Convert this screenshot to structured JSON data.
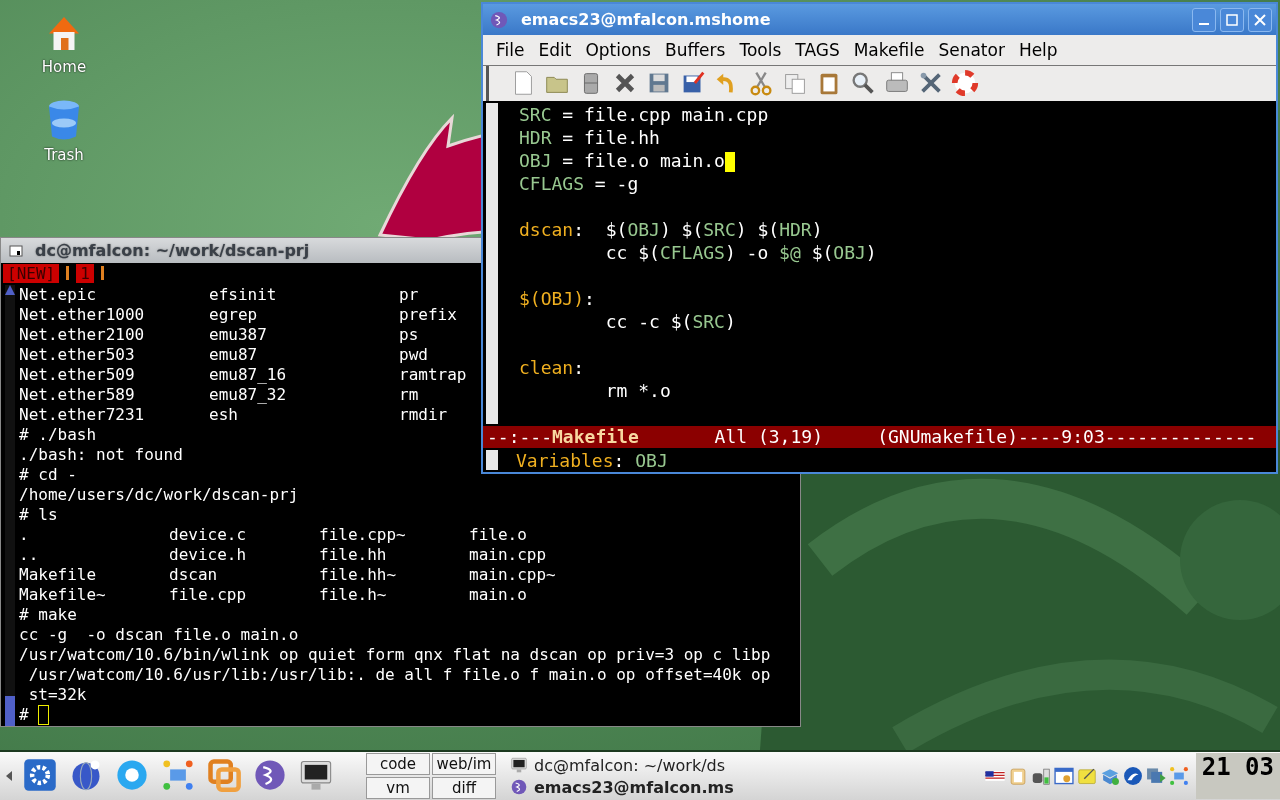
{
  "desktop": {
    "icons": [
      {
        "label": "Home",
        "kind": "home"
      },
      {
        "label": "Trash",
        "kind": "trash"
      }
    ]
  },
  "terminal": {
    "title": "dc@mfalcon: ~/work/dscan-prj",
    "tabs": [
      "[NEW]",
      "1"
    ],
    "lines": [
      {
        "kind": "wide",
        "cells": [
          "Net.epic",
          "efsinit",
          "pr"
        ]
      },
      {
        "kind": "wide",
        "cells": [
          "Net.ether1000",
          "egrep",
          "prefix"
        ]
      },
      {
        "kind": "wide",
        "cells": [
          "Net.ether2100",
          "emu387",
          "ps"
        ]
      },
      {
        "kind": "wide",
        "cells": [
          "Net.ether503",
          "emu87",
          "pwd"
        ]
      },
      {
        "kind": "wide",
        "cells": [
          "Net.ether509",
          "emu87_16",
          "ramtrap"
        ]
      },
      {
        "kind": "wide",
        "cells": [
          "Net.ether589",
          "emu87_32",
          "rm"
        ]
      },
      {
        "kind": "wide",
        "cells": [
          "Net.ether7231",
          "esh",
          "rmdir"
        ]
      },
      {
        "kind": "text",
        "text": "# ./bash"
      },
      {
        "kind": "text",
        "text": "./bash: not found"
      },
      {
        "kind": "text",
        "text": "# cd -"
      },
      {
        "kind": "text",
        "text": "/home/users/dc/work/dscan-prj"
      },
      {
        "kind": "text",
        "text": "# ls"
      },
      {
        "kind": "narrow",
        "cells": [
          ".",
          "device.c",
          "file.cpp~",
          "file.o"
        ]
      },
      {
        "kind": "narrow",
        "cells": [
          "..",
          "device.h",
          "file.hh",
          "main.cpp"
        ]
      },
      {
        "kind": "narrow",
        "cells": [
          "Makefile",
          "dscan",
          "file.hh~",
          "main.cpp~"
        ]
      },
      {
        "kind": "narrow",
        "cells": [
          "Makefile~",
          "file.cpp",
          "file.h~",
          "main.o"
        ]
      },
      {
        "kind": "text",
        "text": "# make"
      },
      {
        "kind": "text",
        "text": "cc -g  -o dscan file.o main.o"
      },
      {
        "kind": "text",
        "text": "/usr/watcom/10.6/bin/wlink op quiet form qnx flat na dscan op priv=3 op c libp"
      },
      {
        "kind": "text",
        "text": " /usr/watcom/10.6/usr/lib:/usr/lib:. de all f file.o f main.o op offset=40k op"
      },
      {
        "kind": "text",
        "text": " st=32k"
      },
      {
        "kind": "prompt",
        "text": "#"
      }
    ]
  },
  "emacs": {
    "title": "emacs23@mfalcon.mshome",
    "menu": [
      "File",
      "Edit",
      "Options",
      "Buffers",
      "Tools",
      "TAGS",
      "Makefile",
      "Senator",
      "Help"
    ],
    "lines": [
      {
        "kind": "code",
        "segments": [
          {
            "text": "SRC",
            "kind": "variable"
          },
          {
            "text": " = file.cpp main.cpp",
            "kind": "plain"
          }
        ],
        "cursor": false
      },
      {
        "kind": "code",
        "segments": [
          {
            "text": "HDR",
            "kind": "variable"
          },
          {
            "text": " = file.hh",
            "kind": "plain"
          }
        ],
        "cursor": false
      },
      {
        "kind": "code",
        "segments": [
          {
            "text": "OBJ",
            "kind": "variable"
          },
          {
            "text": " = file.o main.o",
            "kind": "plain"
          }
        ],
        "cursor": true
      },
      {
        "kind": "code",
        "segments": [
          {
            "text": "CFLAGS",
            "kind": "variable"
          },
          {
            "text": " = -g",
            "kind": "plain"
          }
        ],
        "cursor": false
      },
      {
        "kind": "blank"
      },
      {
        "kind": "code",
        "segments": [
          {
            "text": "dscan",
            "kind": "target"
          },
          {
            "text": ":  $(",
            "kind": "plain"
          },
          {
            "text": "OBJ",
            "kind": "variable"
          },
          {
            "text": ") $(",
            "kind": "plain"
          },
          {
            "text": "SRC",
            "kind": "variable"
          },
          {
            "text": ") $(",
            "kind": "plain"
          },
          {
            "text": "HDR",
            "kind": "variable"
          },
          {
            "text": ")",
            "kind": "plain"
          }
        ],
        "cursor": false
      },
      {
        "kind": "code",
        "segments": [
          {
            "text": "        cc $(",
            "kind": "plain"
          },
          {
            "text": "CFLAGS",
            "kind": "variable"
          },
          {
            "text": ") -o ",
            "kind": "plain"
          },
          {
            "text": "$@",
            "kind": "variable"
          },
          {
            "text": " $(",
            "kind": "plain"
          },
          {
            "text": "OBJ",
            "kind": "variable"
          },
          {
            "text": ")",
            "kind": "plain"
          }
        ],
        "cursor": false
      },
      {
        "kind": "blank"
      },
      {
        "kind": "code",
        "segments": [
          {
            "text": "$(OBJ)",
            "kind": "target"
          },
          {
            "text": ":",
            "kind": "plain"
          }
        ],
        "cursor": false
      },
      {
        "kind": "code",
        "segments": [
          {
            "text": "        cc -c $(",
            "kind": "plain"
          },
          {
            "text": "SRC",
            "kind": "variable"
          },
          {
            "text": ")",
            "kind": "plain"
          }
        ],
        "cursor": false
      },
      {
        "kind": "blank"
      },
      {
        "kind": "code",
        "segments": [
          {
            "text": "clean",
            "kind": "target"
          },
          {
            "text": ":",
            "kind": "plain"
          }
        ],
        "cursor": false
      },
      {
        "kind": "code",
        "segments": [
          {
            "text": "        rm *.o",
            "kind": "plain"
          }
        ],
        "cursor": false
      }
    ],
    "mode_line": [
      {
        "text": "--:---",
        "kind": "plain"
      },
      {
        "text": "Makefile",
        "kind": "buffer"
      },
      {
        "text": "       All (3,19)     (GNUmakefile)----9:03--------------",
        "kind": "plain"
      }
    ],
    "minibuffer": [
      {
        "text": "Variables",
        "kind": "target"
      },
      {
        "text": ": ",
        "kind": "plain"
      },
      {
        "text": "OBJ",
        "kind": "variable"
      }
    ]
  },
  "taskbar": {
    "pager": [
      "code",
      "web/im",
      "vm",
      "diff"
    ],
    "tasks": [
      {
        "label": "dc@mfalcon: ~/work/ds",
        "kind": "terminal",
        "active": false
      },
      {
        "label": "emacs23@mfalcon.ms",
        "kind": "emacs",
        "active": true
      }
    ],
    "clock": "21 03"
  }
}
